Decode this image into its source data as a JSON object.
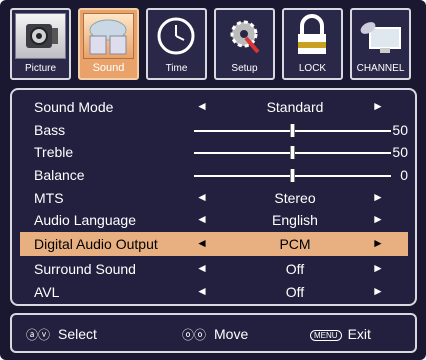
{
  "tabs": [
    {
      "label": "Picture",
      "icon": "camera-icon"
    },
    {
      "label": "Sound",
      "icon": "speaker-icon"
    },
    {
      "label": "Time",
      "icon": "clock-icon"
    },
    {
      "label": "Setup",
      "icon": "gear-wrench-icon"
    },
    {
      "label": "LOCK",
      "icon": "padlock-icon"
    },
    {
      "label": "CHANNEL",
      "icon": "satellite-monitor-icon"
    }
  ],
  "active_tab": "Sound",
  "menu": {
    "rows": [
      {
        "name": "Sound Mode",
        "type": "option",
        "value": "Standard"
      },
      {
        "name": "Bass",
        "type": "slider",
        "value": "50",
        "level": 0.5
      },
      {
        "name": "Treble",
        "type": "slider",
        "value": "50",
        "level": 0.5
      },
      {
        "name": "Balance",
        "type": "slider",
        "value": "0",
        "level": 0.5
      },
      {
        "name": "MTS",
        "type": "option",
        "value": "Stereo"
      },
      {
        "name": "Audio Language",
        "type": "option",
        "value": "English"
      },
      {
        "name": "Digital Audio Output",
        "type": "option",
        "value": "PCM",
        "highlighted": true
      },
      {
        "name": "Surround Sound",
        "type": "option",
        "value": "Off"
      },
      {
        "name": "AVL",
        "type": "option",
        "value": "Off"
      }
    ],
    "left_arrow": "◄",
    "right_arrow": "►"
  },
  "footer": {
    "select_icon": "ⓐⓥ",
    "select_label": "Select",
    "move_icon": "ⓞⓞ",
    "move_label": "Move",
    "menu_badge": "MENU",
    "exit_label": "Exit"
  },
  "colors": {
    "highlight": "#e8b080",
    "background": "#22203e",
    "active_tab": "#e8a26a"
  }
}
